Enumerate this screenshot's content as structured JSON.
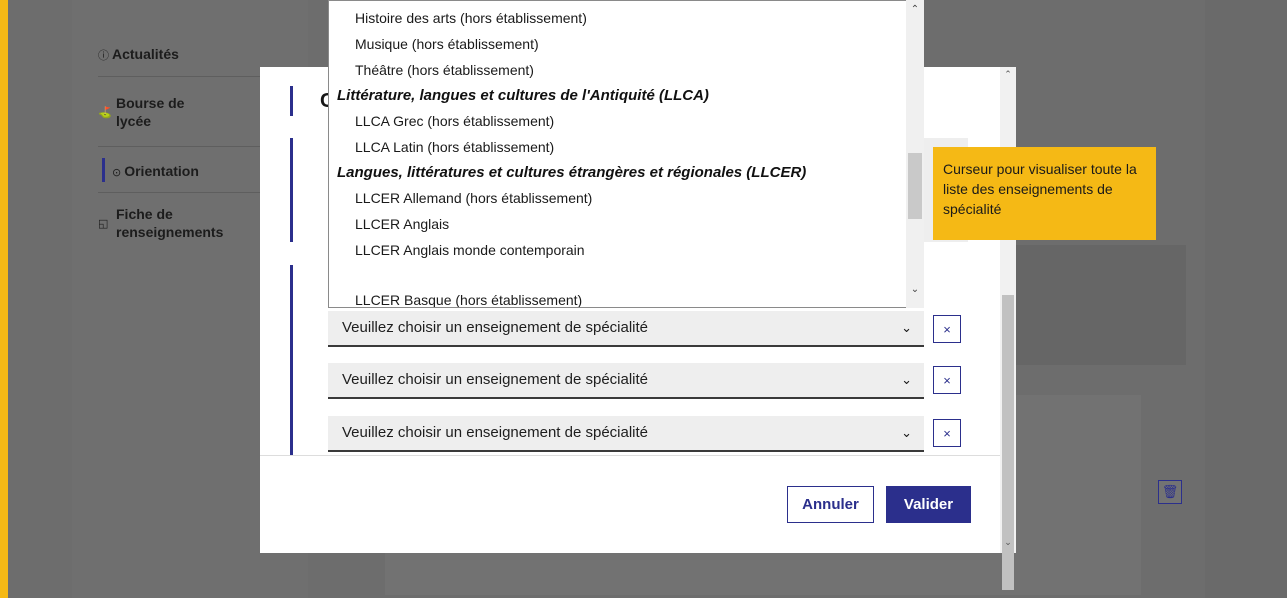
{
  "nav": {
    "items": [
      {
        "icon": "info-icon",
        "label": "Actualités"
      },
      {
        "icon": "scholarship-icon",
        "label_line1": "Bourse de",
        "label_line2": "lycée"
      },
      {
        "icon": "compass-icon",
        "label": "Orientation"
      },
      {
        "icon": "document-icon",
        "label_line1": "Fiche de",
        "label_line2": "renseignements"
      }
    ]
  },
  "modal": {
    "title": "C",
    "selects": [
      {
        "placeholder": "Veuillez choisir un enseignement de spécialité",
        "remove_label": "×"
      },
      {
        "placeholder": "Veuillez choisir un enseignement de spécialité",
        "remove_label": "×"
      },
      {
        "placeholder": "Veuillez choisir un enseignement de spécialité",
        "remove_label": "×"
      }
    ],
    "cancel_label": "Annuler",
    "validate_label": "Valider"
  },
  "dropdown": {
    "opt1": "Histoire des arts (hors établissement)",
    "opt2": "Musique (hors établissement)",
    "opt3": "Théâtre (hors établissement)",
    "group1": "Littérature, langues et cultures de l'Antiquité (LLCA)",
    "opt4": "LLCA Grec (hors établissement)",
    "opt5": "LLCA Latin (hors établissement)",
    "group2": "Langues, littératures et cultures étrangères et régionales (LLCER)",
    "opt6": "LLCER Allemand (hors établissement)",
    "opt7": "LLCER Anglais",
    "opt8": "LLCER Anglais monde contemporain",
    "opt9": "LLCER Basque (hors établissement)"
  },
  "tooltip": {
    "text": "Curseur pour visualiser toute la liste des enseignements de spécialité"
  },
  "icons": {
    "chevron": "chevron-down-icon",
    "trash": "trash-icon"
  },
  "colors": {
    "accent": "#2b2f8c",
    "highlight": "#f5b915"
  }
}
